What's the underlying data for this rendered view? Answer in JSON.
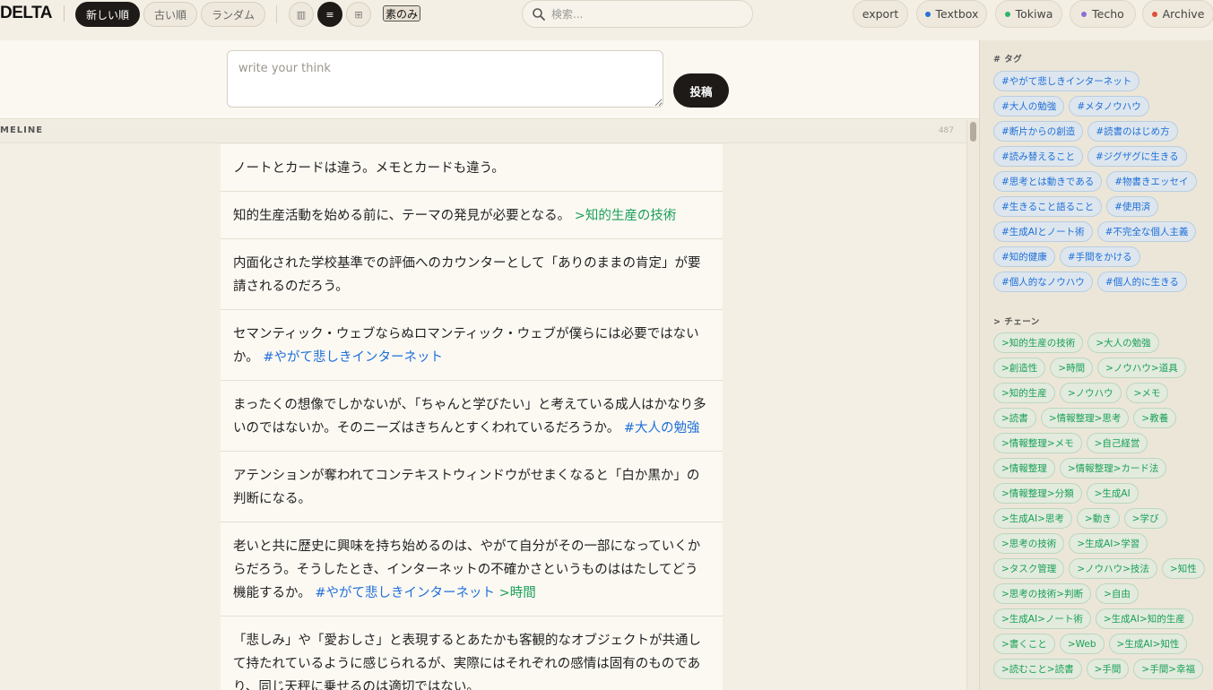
{
  "app": {
    "logo": "DELTA"
  },
  "sort": {
    "newest": "新しい順",
    "oldest": "古い順",
    "random": "ランダム"
  },
  "view": {
    "columns_icon": "▥",
    "list_icon": "≡",
    "grid_icon": "⊞",
    "bare_label": "素のみ"
  },
  "search": {
    "placeholder": "検索..."
  },
  "right_nav": {
    "export": "export",
    "items": [
      {
        "label": "Textbox",
        "color": "#2b6fd6"
      },
      {
        "label": "Tokiwa",
        "color": "#2fb36b"
      },
      {
        "label": "Techo",
        "color": "#8b6fd6"
      },
      {
        "label": "Archive",
        "color": "#e0503a"
      }
    ]
  },
  "composer": {
    "placeholder": "write your think",
    "post_label": "投稿"
  },
  "timeline": {
    "title": "MELINE",
    "count": "487",
    "cards": [
      {
        "parts": [
          {
            "t": "ノートとカードは違う。メモとカードも違う。",
            "k": "text"
          }
        ]
      },
      {
        "parts": [
          {
            "t": "知的生産活動を始める前に、テーマの発見が必要となる。",
            "k": "text"
          },
          {
            "t": " >知的生産の技術",
            "k": "chain"
          }
        ]
      },
      {
        "parts": [
          {
            "t": "内面化された学校基準での評価へのカウンターとして「ありのままの肯定」が要請されるのだろう。",
            "k": "text"
          }
        ]
      },
      {
        "parts": [
          {
            "t": "セマンティック・ウェブならぬロマンティック・ウェブが僕らには必要ではないか。",
            "k": "text"
          },
          {
            "t": " #やがて悲しきインターネット",
            "k": "tag"
          }
        ]
      },
      {
        "parts": [
          {
            "t": "まったくの想像でしかないが、「ちゃんと学びたい」と考えている成人はかなり多いのではないか。そのニーズはきちんとすくわれているだろうか。",
            "k": "text"
          },
          {
            "t": " #大人の勉強",
            "k": "tag"
          }
        ]
      },
      {
        "parts": [
          {
            "t": "アテンションが奪われてコンテキストウィンドウがせまくなると「白か黒か」の判断になる。",
            "k": "text"
          }
        ]
      },
      {
        "parts": [
          {
            "t": "老いと共に歴史に興味を持ち始めるのは、やがて自分がその一部になっていくからだろう。そうしたとき、インターネットの不確かさというものははたしてどう機能するか。",
            "k": "text"
          },
          {
            "t": " #やがて悲しきインターネット",
            "k": "tag"
          },
          {
            "t": " >時間",
            "k": "chain"
          }
        ]
      },
      {
        "parts": [
          {
            "t": "「悲しみ」や「愛おしさ」と表現するとあたかも客観的なオブジェクトが共通して持たれているように感じられるが、実際にはそれぞれの感情は固有のものであり、同じ天秤に乗せるのは適切ではない。",
            "k": "text"
          }
        ]
      }
    ]
  },
  "sidebar": {
    "tags_title": "# タグ",
    "tags": [
      "#やがて悲しきインターネット",
      "#大人の勉強",
      "#メタノウハウ",
      "#断片からの創造",
      "#読書のはじめ方",
      "#読み替えること",
      "#ジグザグに生きる",
      "#思考とは動きである",
      "#物書きエッセイ",
      "#生きること語ること",
      "#使用済",
      "#生成AIとノート術",
      "#不完全な個人主義",
      "#知的健康",
      "#手間をかける",
      "#個人的なノウハウ",
      "#個人的に生きる"
    ],
    "chains_title": "> チェーン",
    "chains": [
      ">知的生産の技術",
      ">大人の勉強",
      ">創造性",
      ">時間",
      ">ノウハウ>道具",
      ">知的生産",
      ">ノウハウ",
      ">メモ",
      ">読書",
      ">情報整理>思考",
      ">教養",
      ">情報整理>メモ",
      ">自己経営",
      ">情報整理",
      ">情報整理>カード法",
      ">情報整理>分類",
      ">生成AI",
      ">生成AI>思考",
      ">動き",
      ">学び",
      ">思考の技術",
      ">生成AI>学習",
      ">タスク管理",
      ">ノウハウ>技法",
      ">知性",
      ">思考の技術>判断",
      ">自由",
      ">生成AI>ノート術",
      ">生成AI>知的生産",
      ">書くこと",
      ">Web",
      ">生成AI>知性",
      ">読むこと>読書",
      ">手間",
      ">手間>幸福"
    ]
  }
}
